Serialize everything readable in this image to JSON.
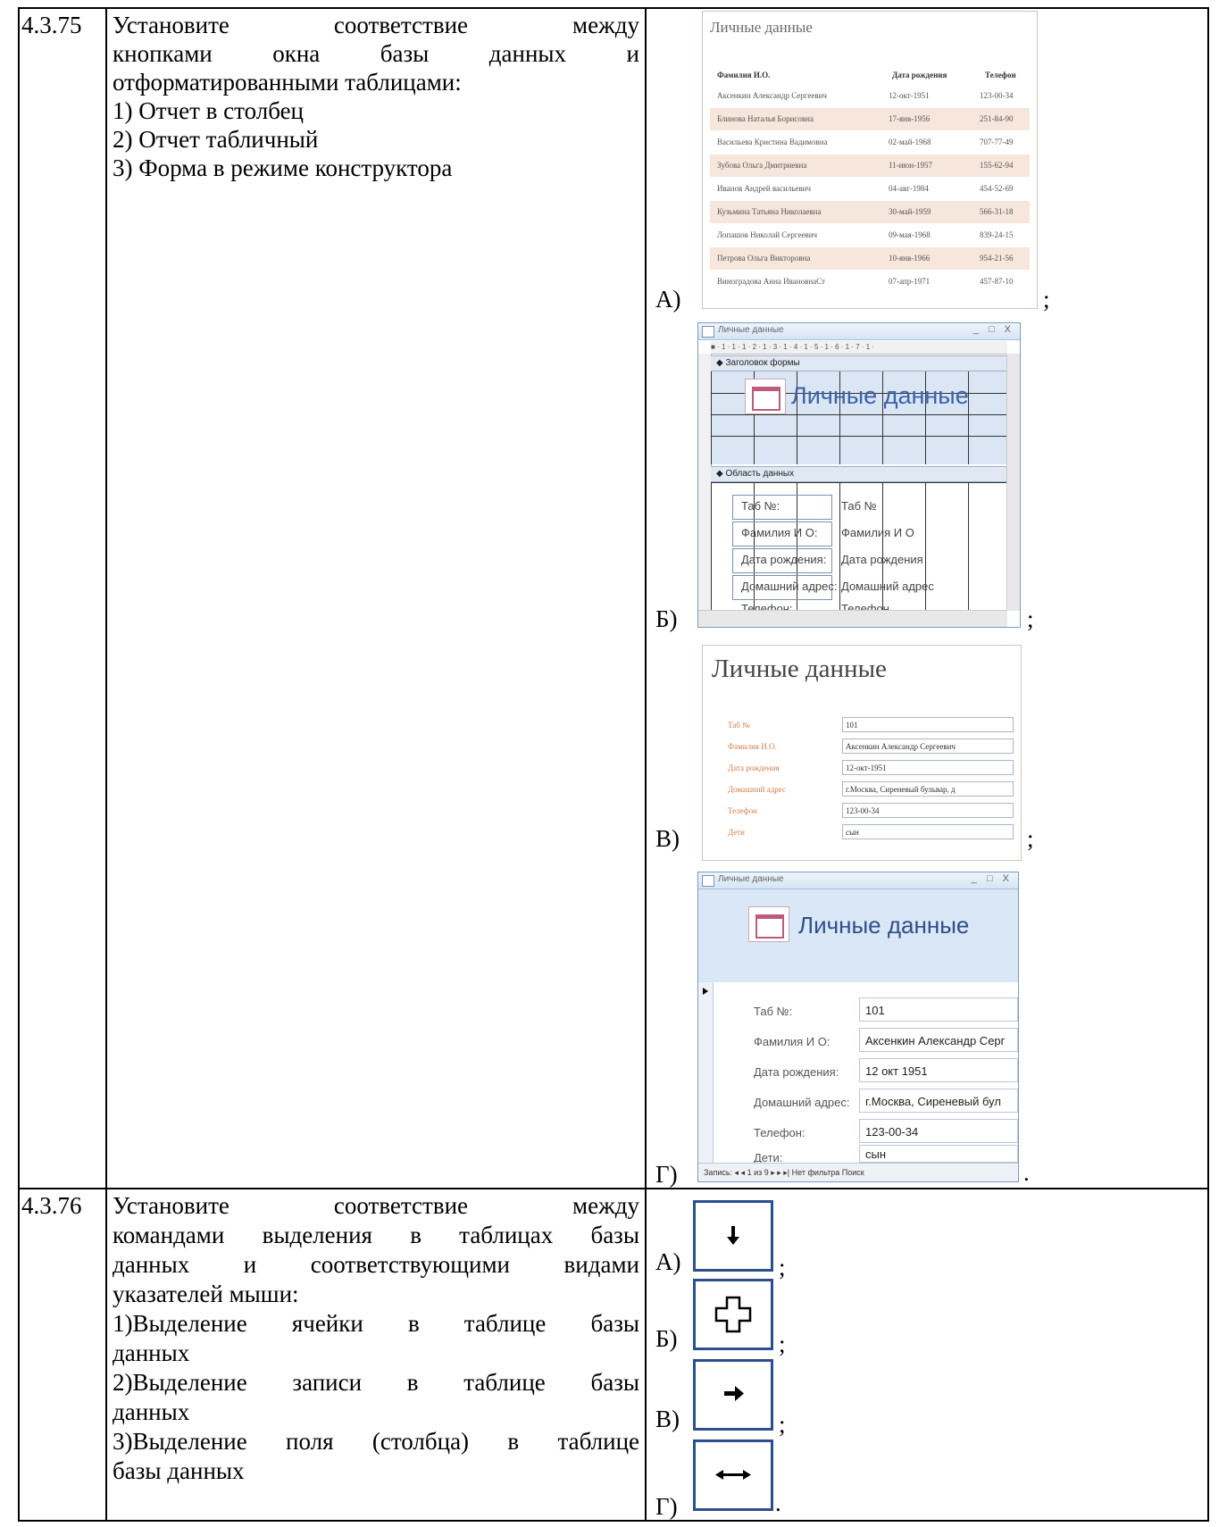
{
  "q75": {
    "number": "4.3.75",
    "text_line1": "Установите соответствие между",
    "text_line2": "кнопками окна базы данных и",
    "text_line3": "отформатированными таблицами:",
    "items": [
      "1) Отчет в столбец",
      "2) Отчет табличный",
      "3) Форма в режиме конструктора"
    ],
    "options": [
      {
        "label": "А)",
        "punct": ";"
      },
      {
        "label": "Б)",
        "punct": ";"
      },
      {
        "label": "В)",
        "punct": ";"
      },
      {
        "label": "Г)",
        "punct": "."
      }
    ]
  },
  "reportA": {
    "title": "Личные данные",
    "headers": [
      "Фамилия И.О.",
      "Дата рождения",
      "Телефон"
    ],
    "rows": [
      [
        "Аксенкин Александр Сергеевич",
        "12-окт-1951",
        "123-00-34"
      ],
      [
        "Блинова Наталья Борисовна",
        "17-янв-1956",
        "251-84-90"
      ],
      [
        "Васильева Кристина Вадимовна",
        "02-май-1968",
        "707-77-49"
      ],
      [
        "Зубова Ольга Дмитриевна",
        "11-июн-1957",
        "155-62-94"
      ],
      [
        "Иванов Андрей васильевич",
        "04-авг-1984",
        "454-52-69"
      ],
      [
        "Кузьмина Татьяна Николаевна",
        "30-май-1959",
        "566-31-18"
      ],
      [
        "Лопашов Николай Сергеевич",
        "09-мая-1968",
        "839-24-15"
      ],
      [
        "Петрова Ольга Викторовна",
        "10-янв-1966",
        "954-21-56"
      ],
      [
        "Виноградова Анна ИвановнаСт",
        "07-апр-1971",
        "457-87-10"
      ]
    ]
  },
  "formB": {
    "window_title": "Личные данные",
    "window_controls": "_ □ X",
    "ruler": "■ · 1 · 1 · 1 · 2 · 1 · 3 · 1 · 4 · 1 · 5 · 1 · 6 · 1 · 7 · 1 ·",
    "header_section": "◆ Заголовок формы",
    "title": "Личные данные",
    "detail_section": "◆ Область данных",
    "fields": [
      {
        "label": "Таб №:",
        "value": "Таб №"
      },
      {
        "label": "Фамилия И О:",
        "value": "Фамилия И О"
      },
      {
        "label": "Дата рождения:",
        "value": "Дата рождения"
      },
      {
        "label": "Домашний адрес:",
        "value": "Домашний адрес"
      },
      {
        "label": "Телефон:",
        "value": "Телефон"
      }
    ]
  },
  "reportC": {
    "title": "Личные данные",
    "fields": [
      {
        "label": "Таб №",
        "value": "101"
      },
      {
        "label": "Фамилия И.О.",
        "value": "Аксенкин Александр Сергеевич"
      },
      {
        "label": "Дата рождения",
        "value": "12-окт-1951"
      },
      {
        "label": "Домашний адрес",
        "value": "г.Москва, Сиреневый бульвар, д"
      },
      {
        "label": "Телефон",
        "value": "123-00-34"
      },
      {
        "label": "Дети",
        "value": "сын"
      }
    ]
  },
  "formD": {
    "window_title": "Личные данные",
    "window_controls": "_ □ X",
    "title": "Личные данные",
    "fields": [
      {
        "label": "Таб №:",
        "value": "101"
      },
      {
        "label": "Фамилия И О:",
        "value": "Аксенкин Александр Серг"
      },
      {
        "label": "Дата рождения:",
        "value": "12 окт 1951"
      },
      {
        "label": "Домашний адрес:",
        "value": "г.Москва, Сиреневый бул"
      },
      {
        "label": "Телефон:",
        "value": "123-00-34"
      },
      {
        "label": "Дети:",
        "value": "сын"
      }
    ],
    "navigation": "Запись: ◂  ◂ 1 из 9  ▸ ▸ ▸|  Нет фильтра   Поиск"
  },
  "q76": {
    "number": "4.3.76",
    "text_line1": "Установите соответствие между",
    "text_line2": "командами выделения в таблицах базы",
    "text_line3": "данных и соответствующими видами",
    "text_line4": "указателей мыши:",
    "item1_line1": "1)Выделение ячейки в таблице базы",
    "item1_line2": "данных",
    "item2_line1": "2)Выделение записи в таблице базы",
    "item2_line2": "данных",
    "item3_line1": "3)Выделение поля (столбца) в таблице",
    "item3_line2": "базы данных",
    "options": [
      {
        "label": "А)",
        "punct": ";",
        "icon": "down-arrow-icon"
      },
      {
        "label": "Б)",
        "punct": ";",
        "icon": "cross-cursor-icon"
      },
      {
        "label": "В)",
        "punct": ";",
        "icon": "right-arrow-icon"
      },
      {
        "label": "Г)",
        "punct": ".",
        "icon": "horizontal-resize-icon"
      }
    ],
    "icon_color": "#2b4f8f"
  }
}
